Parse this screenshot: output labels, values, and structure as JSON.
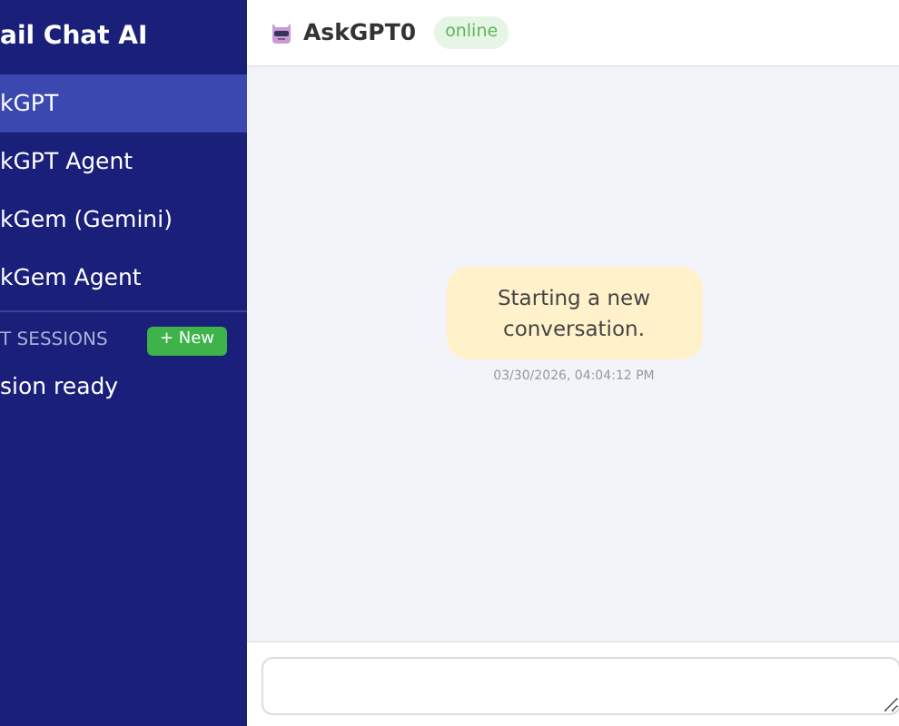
{
  "sidebar": {
    "title": "ail Chat AI",
    "items": [
      {
        "label": "kGPT",
        "selected": true
      },
      {
        "label": "kGPT Agent",
        "selected": false
      },
      {
        "label": "kGem (Gemini)",
        "selected": false
      },
      {
        "label": "kGem Agent",
        "selected": false
      }
    ],
    "sessions": {
      "heading": "T SESSIONS",
      "new_button": "+ New",
      "items": [
        "sion ready"
      ]
    }
  },
  "chat": {
    "name": "AskGPT0",
    "status": "online",
    "messages": [
      {
        "text": "Starting a new conversation.",
        "time": "03/30/2026, 04:04:12 PM"
      }
    ]
  }
}
